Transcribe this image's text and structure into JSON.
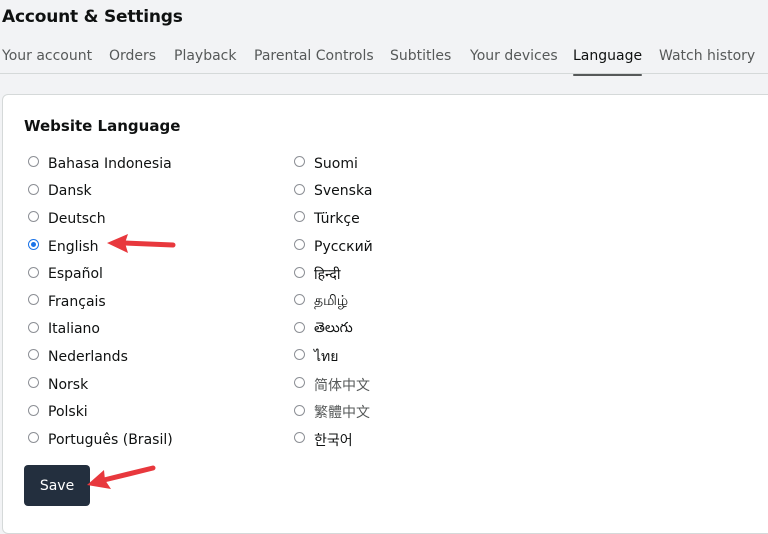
{
  "header": {
    "title": "Account & Settings"
  },
  "tabs": [
    {
      "label": "Your account",
      "active": false
    },
    {
      "label": "Orders",
      "active": false
    },
    {
      "label": "Playback",
      "active": false
    },
    {
      "label": "Parental Controls",
      "active": false
    },
    {
      "label": "Subtitles",
      "active": false
    },
    {
      "label": "Your devices",
      "active": false
    },
    {
      "label": "Language",
      "active": true
    },
    {
      "label": "Watch history",
      "active": false
    }
  ],
  "language_section": {
    "title": "Website Language",
    "selected": "English",
    "left_options": [
      "Bahasa Indonesia",
      "Dansk",
      "Deutsch",
      "English",
      "Español",
      "Français",
      "Italiano",
      "Nederlands",
      "Norsk",
      "Polski",
      "Português (Brasil)"
    ],
    "right_options": [
      "Suomi",
      "Svenska",
      "Türkçe",
      "Русский",
      "हिन्दी",
      "தமிழ்",
      "తెలుగు",
      "ไทย",
      "简体中文",
      "繁體中文",
      "한국어"
    ],
    "save_label": "Save"
  },
  "annotations": {
    "arrow_color": "#e8383d",
    "arrow_targets": [
      "English",
      "Save"
    ]
  },
  "colors": {
    "radio_checked": "#1a73e8",
    "save_button_bg": "#232f3e",
    "page_bg": "#f2f3f5"
  }
}
